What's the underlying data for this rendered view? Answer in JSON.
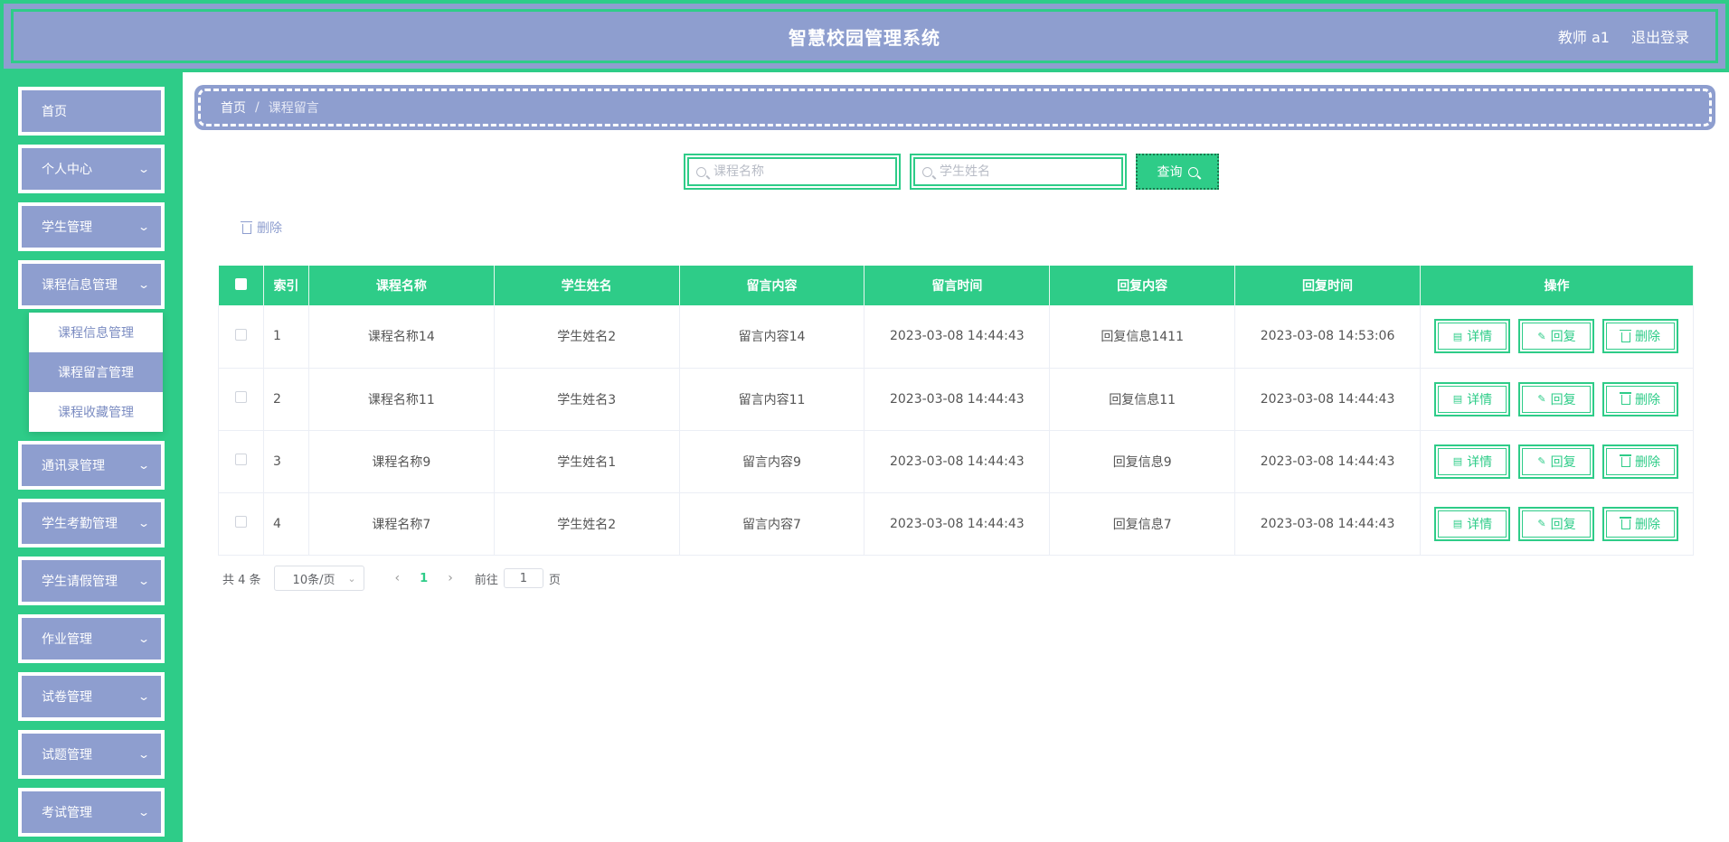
{
  "header": {
    "title": "智慧校园管理系统",
    "user": "教师 a1",
    "logout": "退出登录"
  },
  "sidebar": {
    "items": [
      {
        "label": "首页"
      },
      {
        "label": "个人中心"
      },
      {
        "label": "学生管理"
      },
      {
        "label": "课程信息管理"
      },
      {
        "label": "通讯录管理"
      },
      {
        "label": "学生考勤管理"
      },
      {
        "label": "学生请假管理"
      },
      {
        "label": "作业管理"
      },
      {
        "label": "试卷管理"
      },
      {
        "label": "试题管理"
      },
      {
        "label": "考试管理"
      }
    ],
    "submenu": [
      {
        "label": "课程信息管理"
      },
      {
        "label": "课程留言管理"
      },
      {
        "label": "课程收藏管理"
      }
    ]
  },
  "breadcrumb": {
    "home": "首页",
    "separator": "/",
    "current": "课程留言"
  },
  "search": {
    "course_placeholder": "课程名称",
    "student_placeholder": "学生姓名",
    "query_label": "查询"
  },
  "toolbar": {
    "delete_label": "删除"
  },
  "table": {
    "columns": [
      "索引",
      "课程名称",
      "学生姓名",
      "留言内容",
      "留言时间",
      "回复内容",
      "回复时间",
      "操作"
    ],
    "rows": [
      {
        "index": "1",
        "course": "课程名称14",
        "student": "学生姓名2",
        "content": "留言内容14",
        "time": "2023-03-08 14:44:43",
        "reply": "回复信息1411",
        "reply_time": "2023-03-08 14:53:06"
      },
      {
        "index": "2",
        "course": "课程名称11",
        "student": "学生姓名3",
        "content": "留言内容11",
        "time": "2023-03-08 14:44:43",
        "reply": "回复信息11",
        "reply_time": "2023-03-08 14:44:43"
      },
      {
        "index": "3",
        "course": "课程名称9",
        "student": "学生姓名1",
        "content": "留言内容9",
        "time": "2023-03-08 14:44:43",
        "reply": "回复信息9",
        "reply_time": "2023-03-08 14:44:43"
      },
      {
        "index": "4",
        "course": "课程名称7",
        "student": "学生姓名2",
        "content": "留言内容7",
        "time": "2023-03-08 14:44:43",
        "reply": "回复信息7",
        "reply_time": "2023-03-08 14:44:43"
      }
    ],
    "actions": {
      "detail": "详情",
      "reply": "回复",
      "delete": "删除"
    }
  },
  "pagination": {
    "total": "共 4 条",
    "page_size": "10条/页",
    "current_page": "1",
    "goto_prefix": "前往",
    "goto_value": "1",
    "goto_suffix": "页"
  },
  "colors": {
    "accent_green": "#2ecc88",
    "header_blue": "#8e9ecf"
  }
}
